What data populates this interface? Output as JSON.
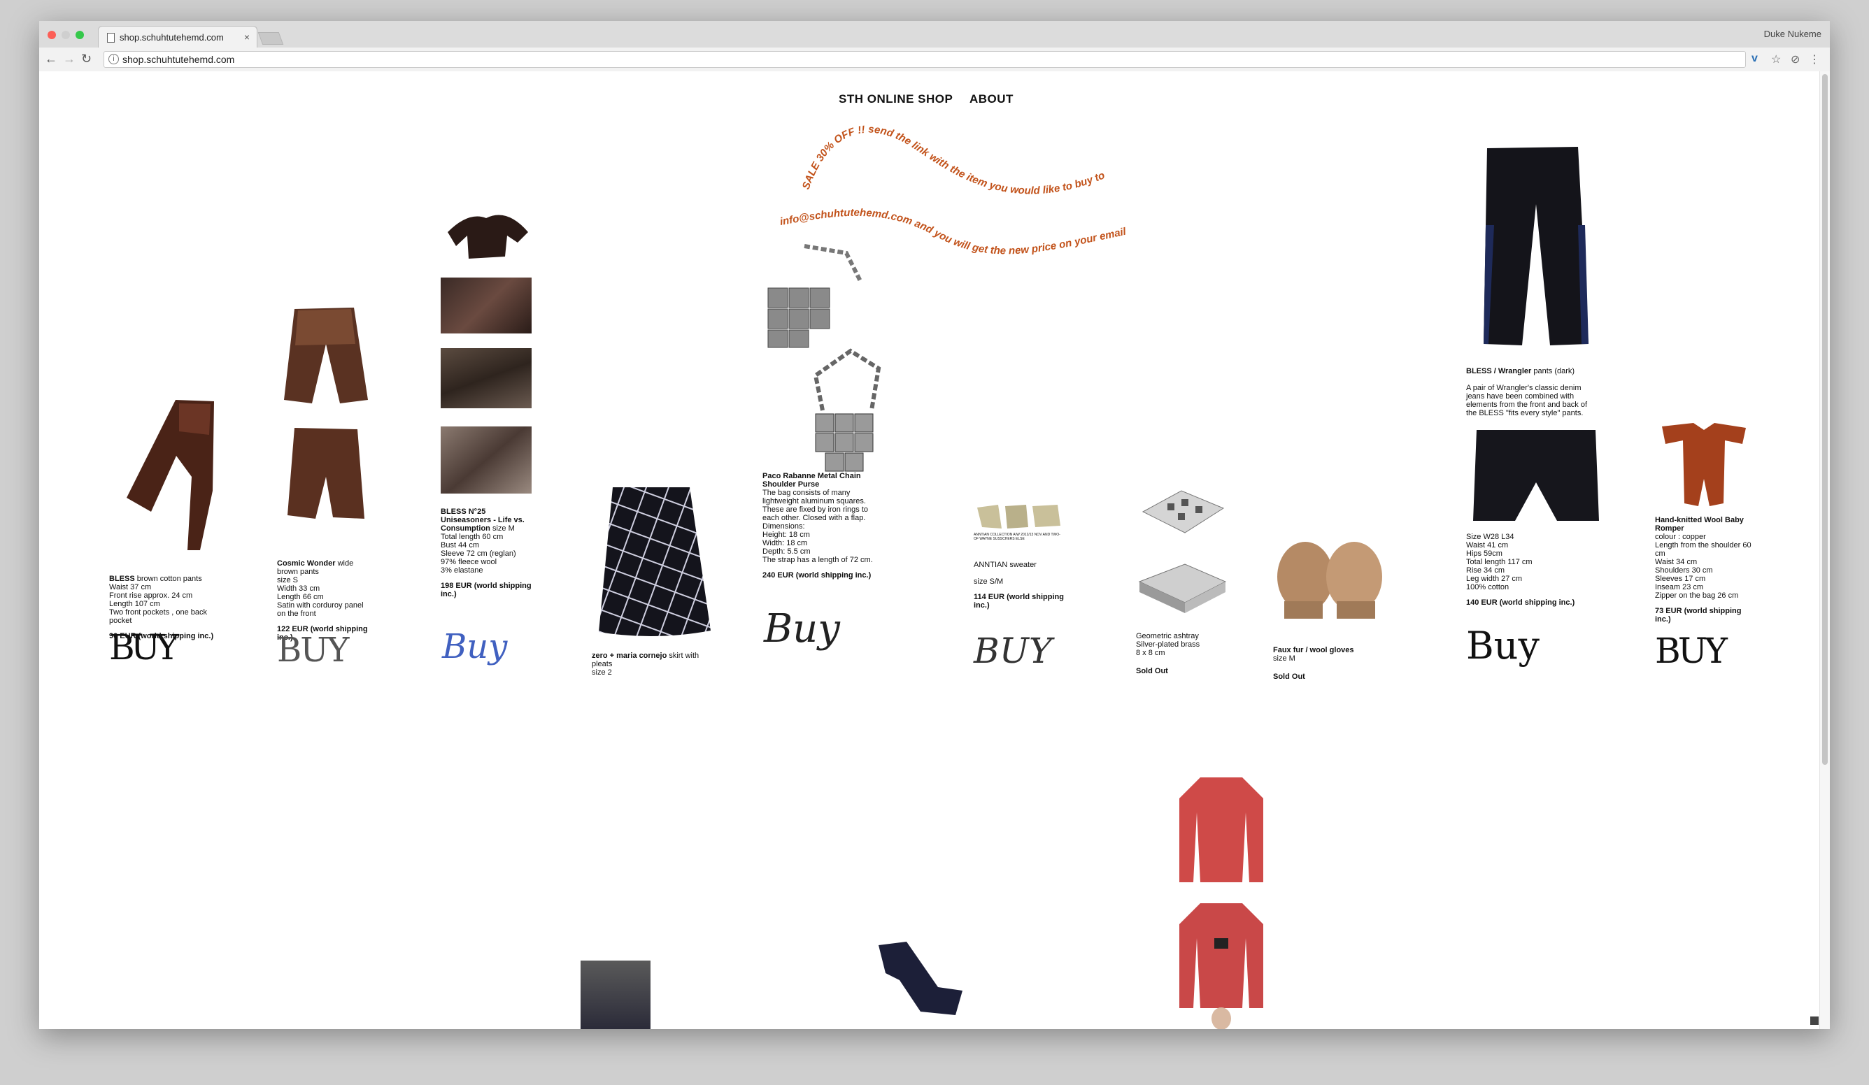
{
  "browser": {
    "tab_title": "shop.schuhtutehemd.com",
    "tab_close": "×",
    "url": "shop.schuhtutehemd.com",
    "user": "Duke Nukeme",
    "back": "←",
    "forward": "→",
    "reload": "↻",
    "info": "i"
  },
  "nav": {
    "shop": "STH ONLINE SHOP",
    "about": "ABOUT"
  },
  "sale_banner": {
    "line1": "SALE 30% OFF !! send the link with the item you would like to buy to",
    "line2": "info@schuhtutehemd.com and you will get the new price on your email",
    "color": "#c2521a"
  },
  "products": [
    {
      "brand": "BLESS",
      "name": " brown cotton pants",
      "desc": "Waist 37 cm\nFront rise approx. 24 cm\nLength 107 cm\nTwo front pockets , one back pocket",
      "price": "90 EUR (world shipping inc.)",
      "buy": "BUY"
    },
    {
      "brand": "Cosmic Wonder",
      "name": " wide brown pants",
      "desc": "size S\nWidth 33 cm\nLength 66 cm\nSatin with corduroy panel on the front",
      "price": "122 EUR (world shipping inc.)",
      "buy": "BUY"
    },
    {
      "brand": "BLESS N°25 Uniseasoners - Life vs. Consumption",
      "name": " size M",
      "desc": "Total length 60 cm\nBust 44 cm\nSleeve 72 cm (reglan)\n97% fleece wool\n3% elastane",
      "price": "198 EUR (world shipping inc.)",
      "buy": "Buy"
    },
    {
      "brand": "zero + maria cornejo",
      "name": " skirt with pleats",
      "desc": "size 2",
      "price": "",
      "buy": ""
    },
    {
      "brand": "Paco Rabanne Metal Chain Shoulder Purse",
      "name": "",
      "desc": "The bag consists of many lightweight aluminum squares. These are fixed by iron rings to each other. Closed with a flap.\nDimensions:\nHeight: 18 cm\nWidth:  18 cm\nDepth: 5.5 cm\nThe strap has a length of 72 cm.",
      "price": "240 EUR (world shipping inc.)",
      "buy": "Buy"
    },
    {
      "brand": "",
      "name": "ANNTIAN sweater",
      "desc": "size S/M",
      "price": "114 EUR (world shipping inc.)",
      "buy": "BUY"
    },
    {
      "brand": "",
      "name": "Geometric ashtray",
      "desc": "Silver-plated brass\n8 x 8 cm",
      "price": "Sold Out",
      "buy": ""
    },
    {
      "brand": "Faux fur / wool gloves",
      "name": "",
      "desc": "size M",
      "price": "Sold Out",
      "buy": ""
    },
    {
      "brand": "BLESS / Wrangler",
      "name": " pants (dark)",
      "desc": "A pair of Wrangler's classic denim jeans have been combined with elements from the front and back of the BLESS \"fits every style\" pants.",
      "desc2": "Size W28 L34\nWaist 41 cm\nHips 59cm\nTotal length 117 cm\nRise 34 cm\nLeg width 27 cm\n100% cotton",
      "price": "140 EUR (world shipping inc.)",
      "buy": "Buy"
    },
    {
      "brand": "Hand-knitted Wool Baby Romper",
      "name": "",
      "desc": "colour : copper\nLength from the shoulder 60 cm\nWaist 34 cm\nShoulders 30 cm\nSleeves 17 cm\nInseam 23 cm\nZipper on the bag 26 cm",
      "price": "73 EUR (world shipping inc.)",
      "buy": "BUY"
    }
  ],
  "anntian_label": "ANNTIAN COLLECTION A/W 2012/13 NOV AND TWO-OF WAYNE SUSSCHERS ELSE",
  "colors": {
    "bg": "#ffffff",
    "text": "#111111",
    "chrome": "#dcdcdc"
  }
}
